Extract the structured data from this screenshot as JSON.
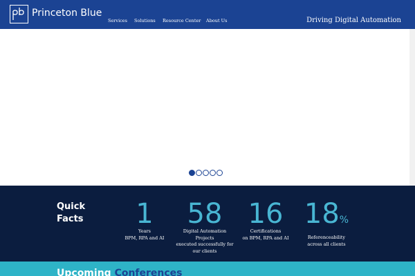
{
  "header": {
    "brand": "Princeton Blue",
    "logo_text": "pb",
    "tagline": "Driving Digital Automation",
    "nav": [
      {
        "label": "Services"
      },
      {
        "label": "Solutions"
      },
      {
        "label": "Resource Center"
      },
      {
        "label": "About Us"
      }
    ]
  },
  "slider": {
    "slide_count": 5,
    "active_index": 0
  },
  "facts": {
    "heading_line1": "Quick",
    "heading_line2": "Facts",
    "items": [
      {
        "number": "1",
        "suffix": "",
        "lines": [
          "Years",
          "BPM, RPA and AI"
        ]
      },
      {
        "number": "58",
        "suffix": "",
        "lines": [
          "Digital Automation",
          "Projects",
          "executed successfully for",
          "our clients"
        ]
      },
      {
        "number": "16",
        "suffix": "",
        "lines": [
          "Certifications",
          "on BPM, RPA and AI"
        ]
      },
      {
        "number": "18",
        "suffix": "%",
        "lines": [
          "Referenceability",
          "across all clients"
        ]
      }
    ]
  },
  "conferences": {
    "title_word1": "Upcoming",
    "title_word2": "Conferences"
  },
  "colors": {
    "header_bg": "#1b4393",
    "facts_bg": "#0b1d3f",
    "accent_number": "#49b6d3",
    "conf_bg": "#2eb3c7"
  }
}
